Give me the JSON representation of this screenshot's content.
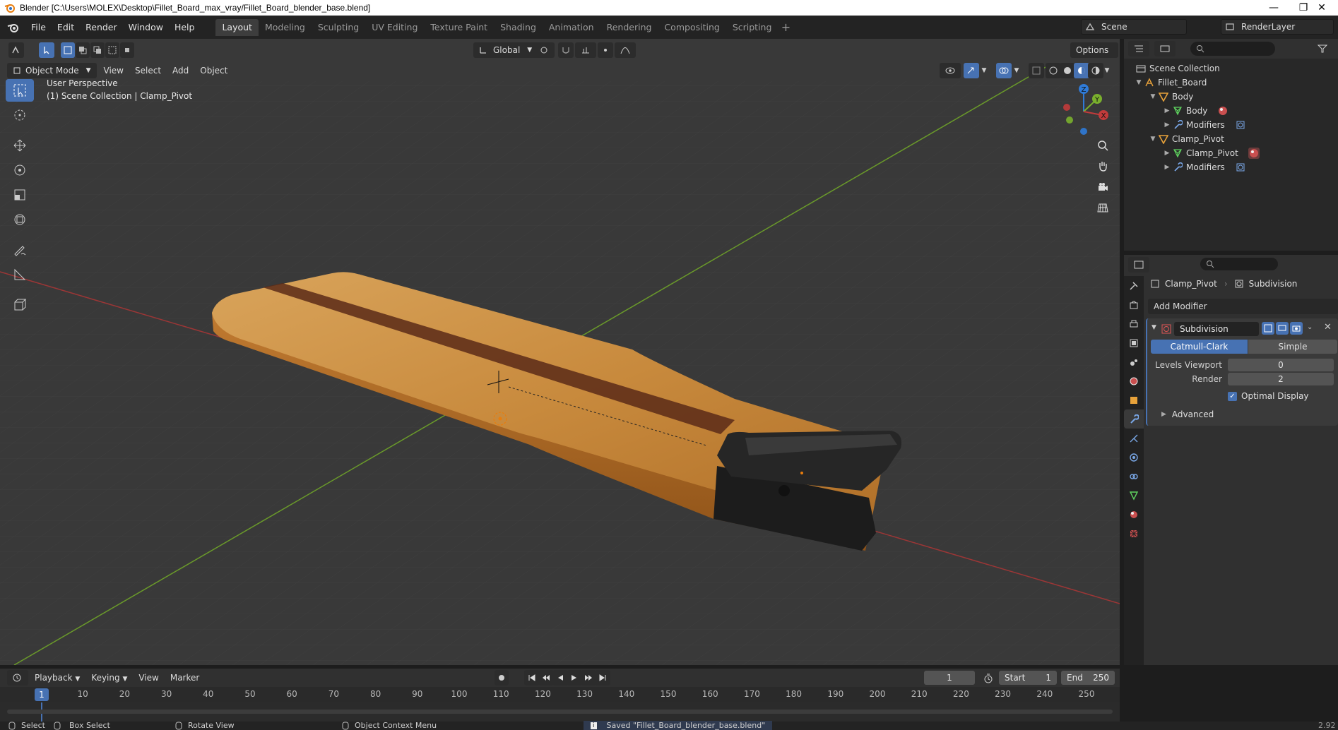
{
  "window": {
    "title": "Blender [C:\\Users\\MOLEX\\Desktop\\Fillet_Board_max_vray/Fillet_Board_blender_base.blend]",
    "minimize": "—",
    "maximize": "❐",
    "close": "✕"
  },
  "menu": {
    "file": "File",
    "edit": "Edit",
    "render": "Render",
    "window": "Window",
    "help": "Help"
  },
  "workspaces": [
    "Layout",
    "Modeling",
    "Sculpting",
    "UV Editing",
    "Texture Paint",
    "Shading",
    "Animation",
    "Rendering",
    "Compositing",
    "Scripting"
  ],
  "workspace_add": "+",
  "scene": {
    "name": "Scene",
    "view_layer": "RenderLayer"
  },
  "viewport": {
    "mode": "Object Mode",
    "menus": [
      "View",
      "Select",
      "Add",
      "Object"
    ],
    "transform_orientation": "Global",
    "options": "Options",
    "perspective": "User Perspective",
    "collection_info": "(1) Scene Collection | Clamp_Pivot",
    "gizmo_labels": {
      "z": "Z",
      "y": "Y",
      "x": "X"
    }
  },
  "outliner": {
    "search_placeholder": "",
    "items": [
      {
        "label": "Scene Collection"
      },
      {
        "label": "Fillet_Board"
      },
      {
        "label": "Body"
      },
      {
        "label": "Body"
      },
      {
        "label": "Modifiers"
      },
      {
        "label": "Clamp_Pivot"
      },
      {
        "label": "Clamp_Pivot"
      },
      {
        "label": "Modifiers"
      }
    ]
  },
  "properties": {
    "search_placeholder": "",
    "breadcrumb_object": "Clamp_Pivot",
    "breadcrumb_modifier": "Subdivision",
    "add_modifier": "Add Modifier",
    "modifier": {
      "name": "Subdivision",
      "type_options": [
        "Catmull-Clark",
        "Simple"
      ],
      "selected_type": "Catmull-Clark",
      "levels_viewport_label": "Levels Viewport",
      "levels_viewport": "0",
      "render_label": "Render",
      "render": "2",
      "optimal_display_label": "Optimal Display",
      "optimal_display": true,
      "advanced_label": "Advanced"
    }
  },
  "timeline": {
    "menus": [
      "Playback",
      "Keying",
      "View",
      "Marker"
    ],
    "current_frame": "1",
    "start_label": "Start",
    "start": "1",
    "end_label": "End",
    "end": "250",
    "ticks": [
      "10",
      "20",
      "30",
      "40",
      "50",
      "60",
      "70",
      "80",
      "90",
      "100",
      "110",
      "120",
      "130",
      "140",
      "150",
      "160",
      "170",
      "180",
      "190",
      "200",
      "210",
      "220",
      "230",
      "240",
      "250"
    ]
  },
  "statusbar": {
    "select": "Select",
    "box_select": "Box Select",
    "rotate_view": "Rotate View",
    "context_menu": "Object Context Menu",
    "message": "Saved \"Fillet_Board_blender_base.blend\"",
    "version": "2.92"
  },
  "colors": {
    "accent": "#4772b3",
    "x_axis": "#c23b3b",
    "y_axis": "#7ab02d",
    "z_axis": "#2f7bd8"
  }
}
